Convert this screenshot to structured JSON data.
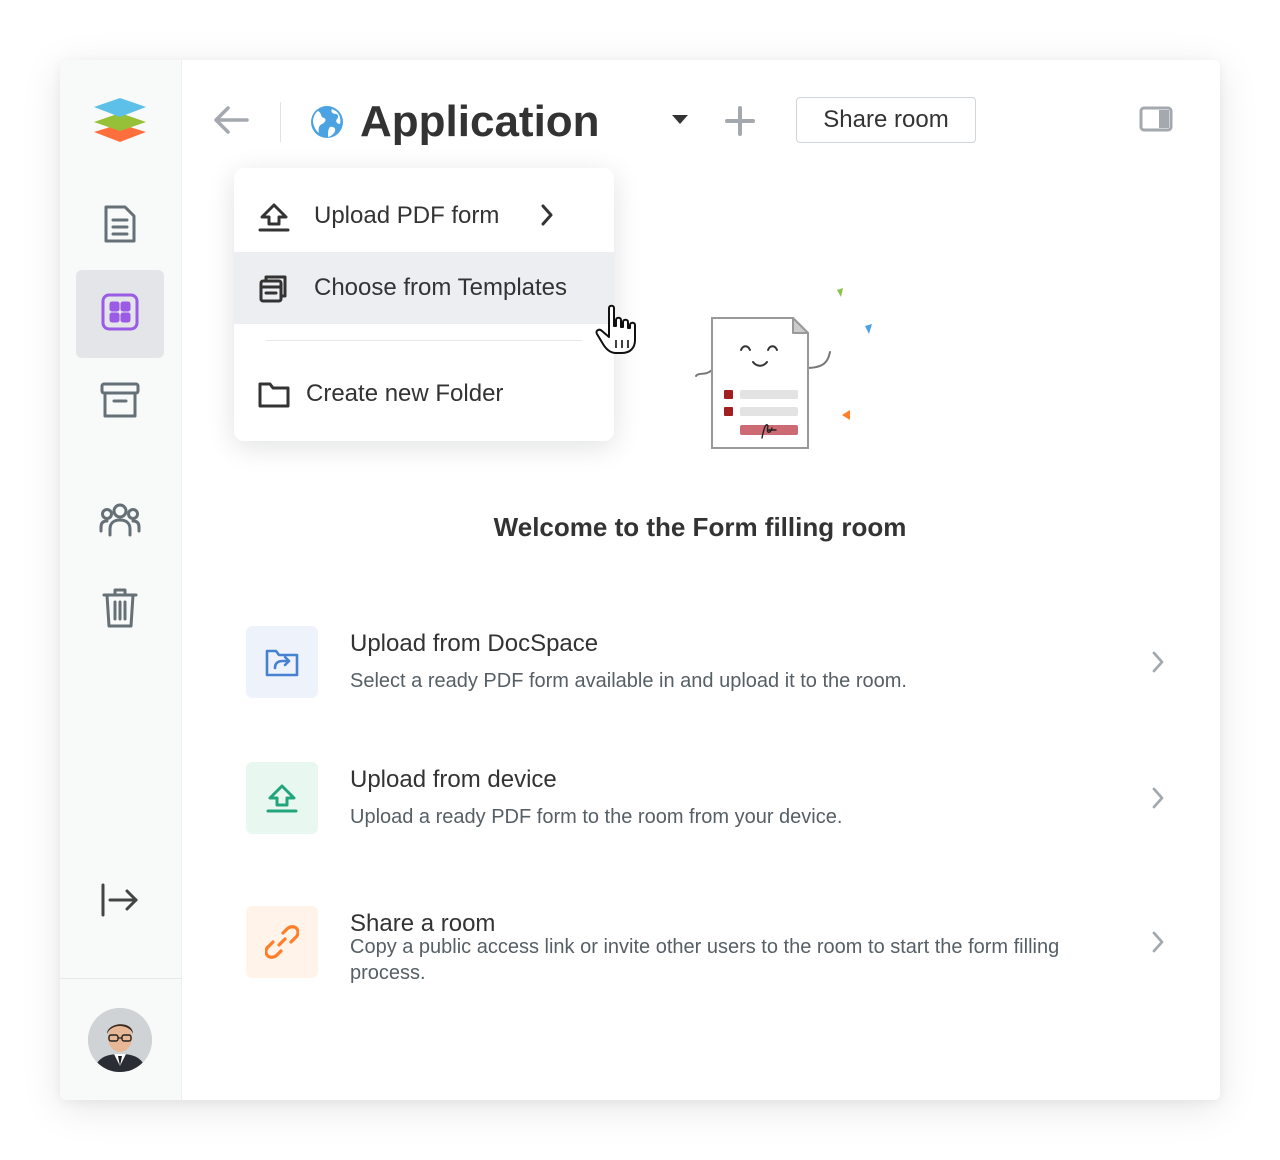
{
  "header": {
    "room_title": "Application",
    "share_button_label": "Share room"
  },
  "dropdown_menu": {
    "items": [
      {
        "label": "Upload PDF form",
        "icon": "upload-icon",
        "has_submenu": true
      },
      {
        "label": "Choose from Templates",
        "icon": "templates-icon",
        "hovered": true
      },
      {
        "label": "Create new Folder",
        "icon": "folder-icon"
      }
    ]
  },
  "sidebar": {
    "items": [
      {
        "icon": "documents-icon"
      },
      {
        "icon": "rooms-icon",
        "active": true
      },
      {
        "icon": "archive-icon"
      },
      {
        "icon": "people-icon"
      },
      {
        "icon": "trash-icon"
      },
      {
        "icon": "logout-icon"
      }
    ],
    "avatar": "user-avatar"
  },
  "main": {
    "welcome_title": "Welcome to the Form filling room",
    "options": [
      {
        "title": "Upload from DocSpace",
        "description": "Select a ready PDF form available in and upload it to the room.",
        "icon": "docspace-folder-icon",
        "color": "#4781d1",
        "bg": "#eef3fb"
      },
      {
        "title": "Upload from device",
        "description": "Upload a ready PDF form to the room from your device.",
        "icon": "upload-device-icon",
        "color": "#22a57c",
        "bg": "#e9f7f1"
      },
      {
        "title": "Share a room",
        "description": "Copy a public access link or invite other users to the room to start the form filling process.",
        "icon": "link-icon",
        "color": "#ff7e27",
        "bg": "#fff3ea"
      }
    ]
  },
  "colors": {
    "accent_purple": "#9a5ce4",
    "text": "#333333",
    "muted": "#555f65"
  }
}
